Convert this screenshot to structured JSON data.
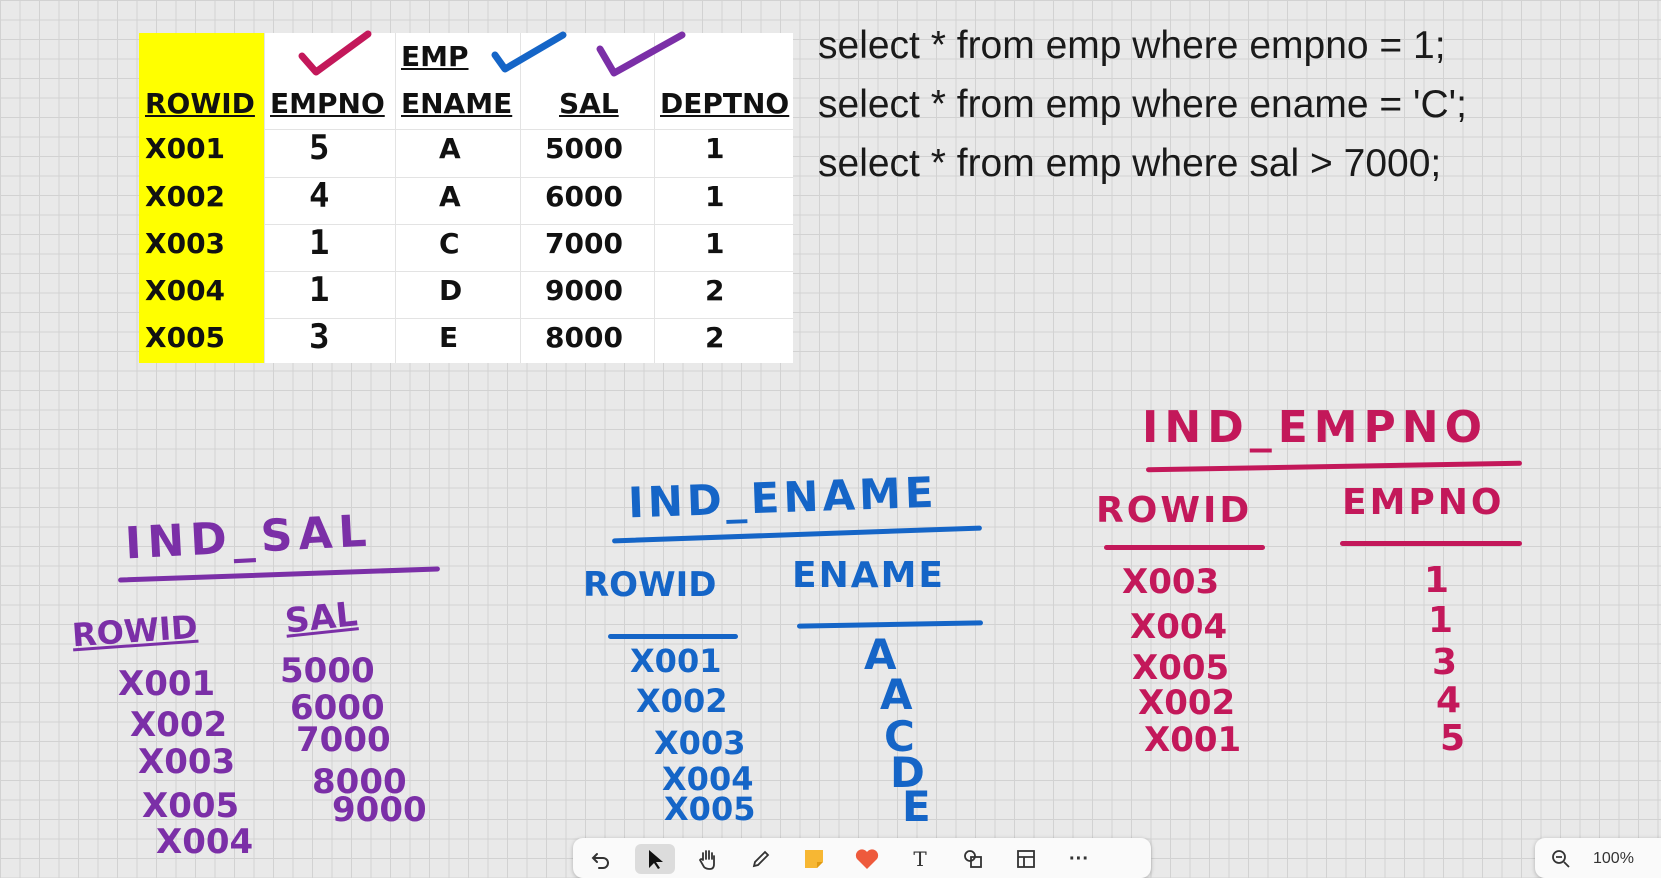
{
  "table": {
    "title": "EMP",
    "headers": [
      "ROWID",
      "EMPNO",
      "ENAME",
      "SAL",
      "DEPTNO"
    ],
    "rows": [
      [
        "X001",
        "5",
        "A",
        "5000",
        "1"
      ],
      [
        "X002",
        "4",
        "A",
        "6000",
        "1"
      ],
      [
        "X003",
        "1",
        "C",
        "7000",
        "1"
      ],
      [
        "X004",
        "1",
        "D",
        "9000",
        "2"
      ],
      [
        "X005",
        "3",
        "E",
        "8000",
        "2"
      ]
    ]
  },
  "queries": [
    "select * from emp where empno = 1;",
    "select * from emp where ename = 'C';",
    "select * from emp where sal > 7000;"
  ],
  "colors": {
    "purple": "#7b2fa7",
    "blue": "#1565c7",
    "pink": "#c3185a",
    "rowid_highlight": "#ffff00"
  },
  "ind_sal": {
    "title": "IND_SAL",
    "col1": "ROWID",
    "col2": "SAL",
    "rowids": [
      "X001",
      "X002",
      "X003",
      "X005",
      "X004"
    ],
    "values": [
      "5000",
      "6000",
      "7000",
      "8000",
      "9000"
    ]
  },
  "ind_ename": {
    "title": "IND_ENAME",
    "col1": "ROWID",
    "col2": "ENAME",
    "rowids": [
      "X001",
      "X002",
      "X003",
      "X004",
      "X005"
    ],
    "values": [
      "A",
      "A",
      "C",
      "D",
      "E"
    ]
  },
  "ind_empno": {
    "title": "IND_EMPNO",
    "col1": "ROWID",
    "col2": "EMPNO",
    "rowids": [
      "X003",
      "X004",
      "X005",
      "X002",
      "X001"
    ],
    "values": [
      "1",
      "1",
      "3",
      "4",
      "5"
    ]
  },
  "toolbar": {
    "icons": [
      "undo-icon",
      "select-pointer-icon",
      "hand-pan-icon",
      "pen-icon",
      "sticky-note-icon",
      "reaction-heart-icon",
      "text-icon",
      "shapes-icon",
      "table-icon",
      "more-icon"
    ],
    "text_label": "T",
    "more_label": "···"
  },
  "zoom": {
    "label": "100%"
  }
}
